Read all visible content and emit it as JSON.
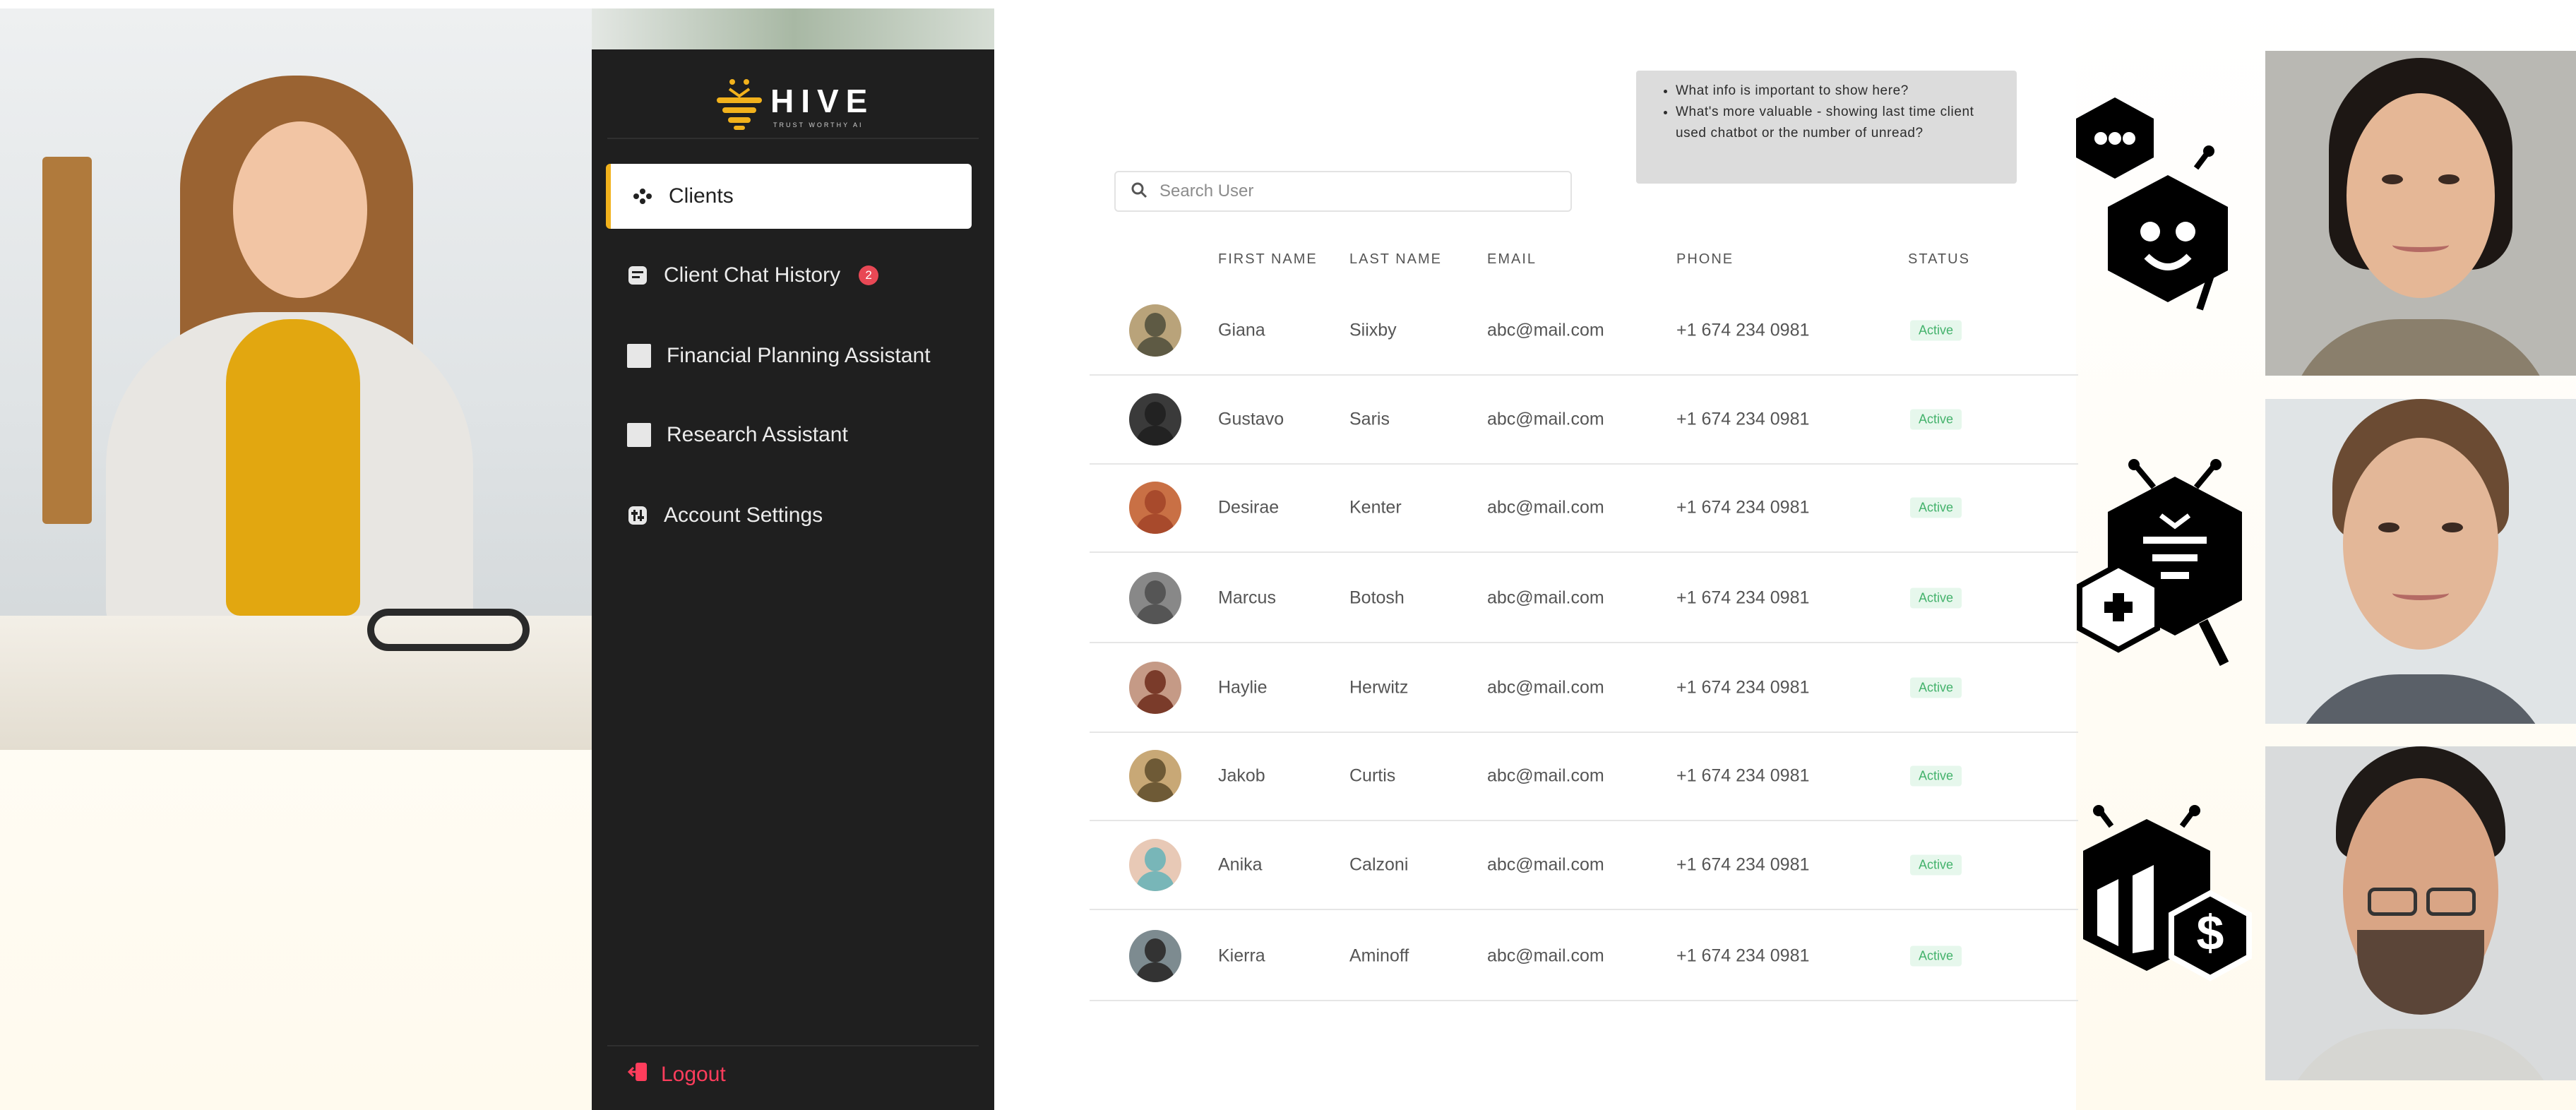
{
  "brand": {
    "name": "HIVE",
    "tagline": "TRUST WORTHY AI"
  },
  "sidebar": {
    "items": [
      {
        "label": "Clients",
        "icon": "users-icon",
        "active": true
      },
      {
        "label": "Client Chat History",
        "icon": "chat-history-icon",
        "badge": "2"
      },
      {
        "label": "Financial Planning Assistant",
        "icon": "square-icon"
      },
      {
        "label": "Research Assistant",
        "icon": "square-icon"
      },
      {
        "label": "Account Settings",
        "icon": "settings-icon"
      }
    ],
    "logout_label": "Logout"
  },
  "note": {
    "lines": [
      "What info is important to show here?",
      "What's more valuable - showing last time client used chatbot or the number of unread?"
    ]
  },
  "search": {
    "placeholder": "Search User",
    "value": ""
  },
  "table": {
    "columns": [
      "FIRST NAME",
      "LAST NAME",
      "EMAIL",
      "PHONE",
      "STATUS"
    ],
    "rows": [
      {
        "first": "Giana",
        "last": "Siixby",
        "email": "abc@mail.com",
        "phone": "+1 674 234 0981",
        "status": "Active"
      },
      {
        "first": "Gustavo",
        "last": "Saris",
        "email": "abc@mail.com",
        "phone": "+1 674 234 0981",
        "status": "Active"
      },
      {
        "first": "Desirae",
        "last": "Kenter",
        "email": "abc@mail.com",
        "phone": "+1 674 234 0981",
        "status": "Active"
      },
      {
        "first": "Marcus",
        "last": "Botosh",
        "email": "abc@mail.com",
        "phone": "+1 674 234 0981",
        "status": "Active"
      },
      {
        "first": "Haylie",
        "last": "Herwitz",
        "email": "abc@mail.com",
        "phone": "+1 674 234 0981",
        "status": "Active"
      },
      {
        "first": "Jakob",
        "last": "Curtis",
        "email": "abc@mail.com",
        "phone": "+1 674 234 0981",
        "status": "Active"
      },
      {
        "first": "Anika",
        "last": "Calzoni",
        "email": "abc@mail.com",
        "phone": "+1 674 234 0981",
        "status": "Active"
      },
      {
        "first": "Kierra",
        "last": "Aminoff",
        "email": "abc@mail.com",
        "phone": "+1 674 234 0981",
        "status": "Active"
      }
    ]
  },
  "colors": {
    "sidebar_bg": "#1f1f1f",
    "accent": "#f2b21c",
    "badge": "#e84855",
    "logout": "#ff3d5c",
    "status_bg": "#e6f7ec",
    "status_text": "#43b26b"
  },
  "illustrations": [
    "chatbot-icon",
    "research-hive-icon",
    "finance-hive-icon"
  ]
}
